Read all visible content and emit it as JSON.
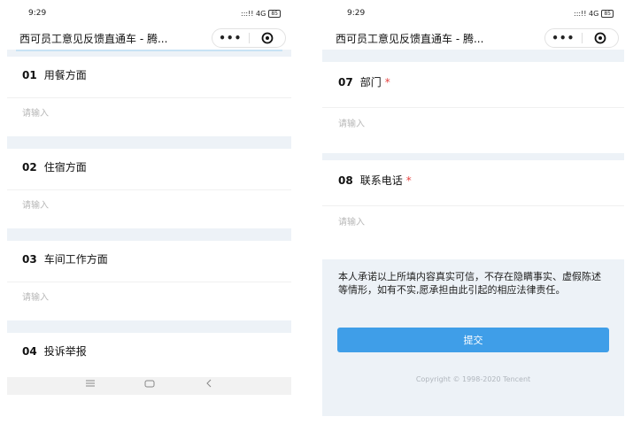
{
  "left": {
    "status": {
      "time": "9:29",
      "signal": ":::!! 4G",
      "battery": "85"
    },
    "title": "西可员工意见反馈直通车 - 腾...",
    "capsule": {
      "more": "•••"
    },
    "questions": [
      {
        "num": "01",
        "label": "用餐方面",
        "placeholder": "请输入"
      },
      {
        "num": "02",
        "label": "住宿方面",
        "placeholder": "请输入"
      },
      {
        "num": "03",
        "label": "车间工作方面",
        "placeholder": "请输入"
      },
      {
        "num": "04",
        "label": "投诉举报"
      }
    ]
  },
  "right": {
    "status": {
      "time": "9:29",
      "signal": ":::!! 4G",
      "battery": "85"
    },
    "title": "西可员工意见反馈直通车 - 腾...",
    "capsule": {
      "more": "•••"
    },
    "questions": [
      {
        "num": "07",
        "label": "部门",
        "required": "*",
        "placeholder": "请输入"
      },
      {
        "num": "08",
        "label": "联系电话",
        "required": "*",
        "placeholder": "请输入"
      }
    ],
    "declaration": "本人承诺以上所填内容真实可信，不存在隐瞒事实、虚假陈述等情形，如有不实,愿承担由此引起的相应法律责任。",
    "submit_label": "提交",
    "copyright": "Copyright © 1998-2020 Tencent"
  },
  "nav": {
    "menu_icon": "menu-icon",
    "home_icon": "home-icon",
    "back_icon": "back-icon"
  },
  "colors": {
    "accent": "#3f9ee8",
    "required": "#e64340",
    "page_bg": "#edf2f7"
  }
}
